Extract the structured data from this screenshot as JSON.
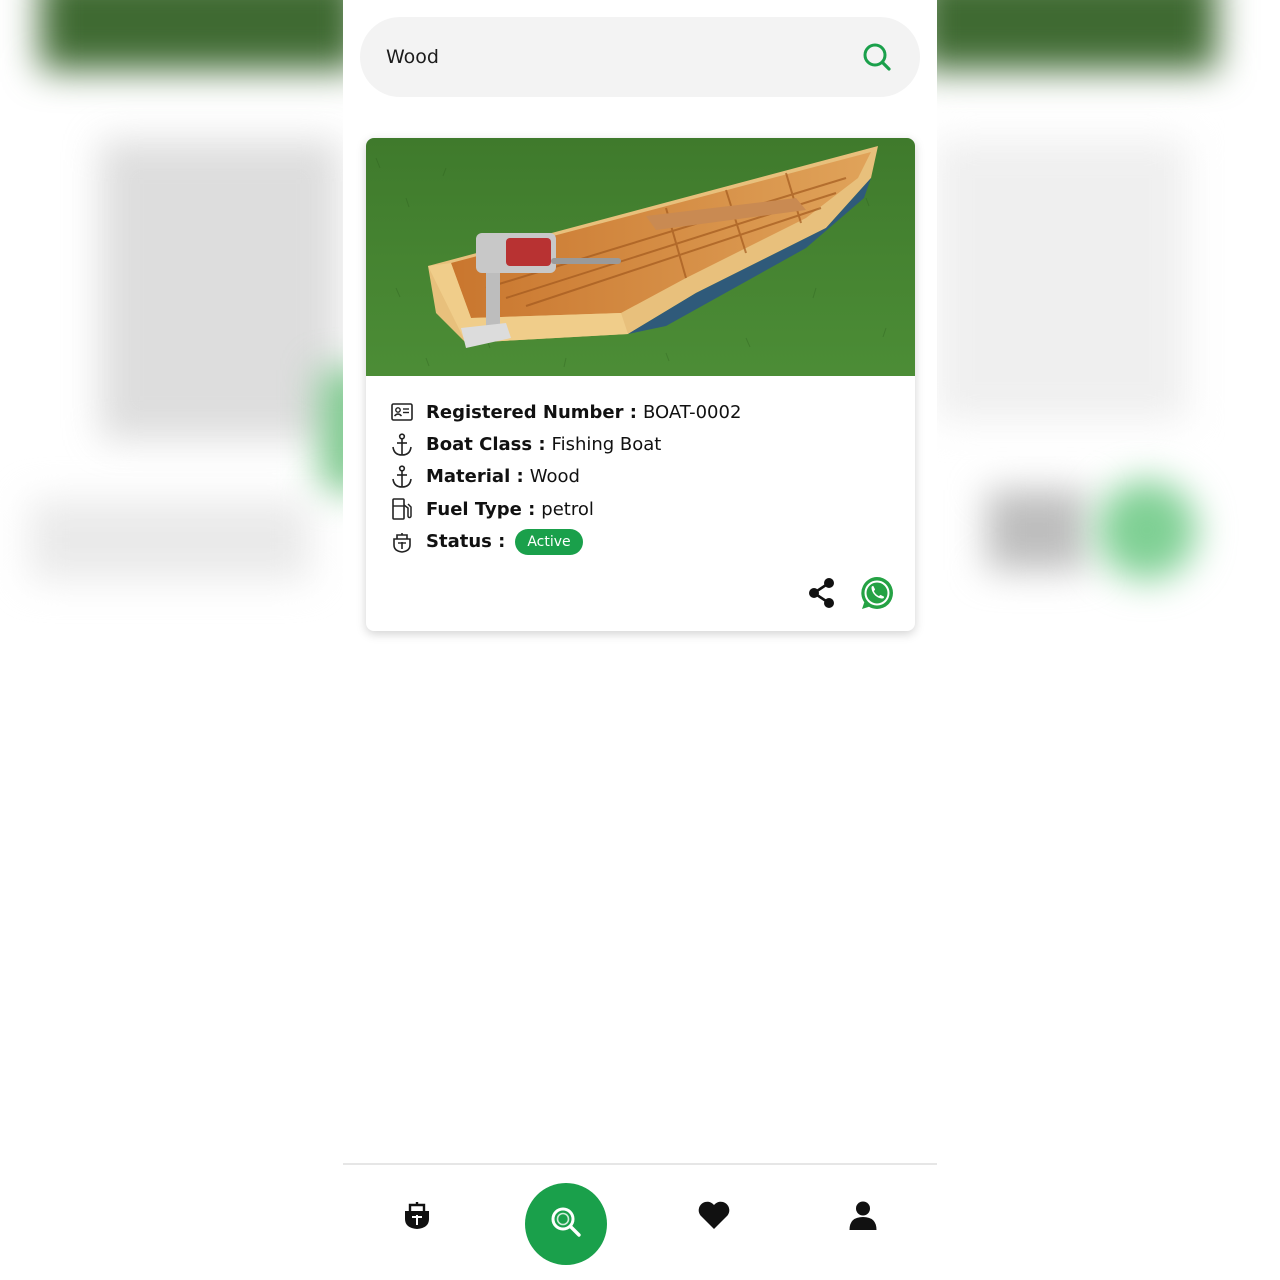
{
  "search": {
    "value": "Wood"
  },
  "card": {
    "image_alt": "Wooden boat with outboard motor on grass",
    "fields": [
      {
        "icon": "id-card-icon",
        "label": "Registered Number :",
        "value": "BOAT-0002"
      },
      {
        "icon": "anchor-icon",
        "label": "Boat Class :",
        "value": "Fishing Boat"
      },
      {
        "icon": "anchor-icon",
        "label": "Material :",
        "value": "Wood"
      },
      {
        "icon": "fuel-pump-icon",
        "label": "Fuel Type :",
        "value": "petrol"
      },
      {
        "icon": "boat-icon",
        "label": "Status :",
        "value": ""
      }
    ],
    "status_badge": "Active"
  },
  "nav": {
    "items": [
      {
        "icon": "boat-icon",
        "name": "boats"
      },
      {
        "icon": "search-icon",
        "name": "search",
        "active": true
      },
      {
        "icon": "heart-icon",
        "name": "favorites"
      },
      {
        "icon": "user-icon",
        "name": "profile"
      }
    ]
  },
  "colors": {
    "accent": "#1aa04b",
    "whatsapp": "#25a244",
    "search_bg": "#f3f3f3"
  }
}
